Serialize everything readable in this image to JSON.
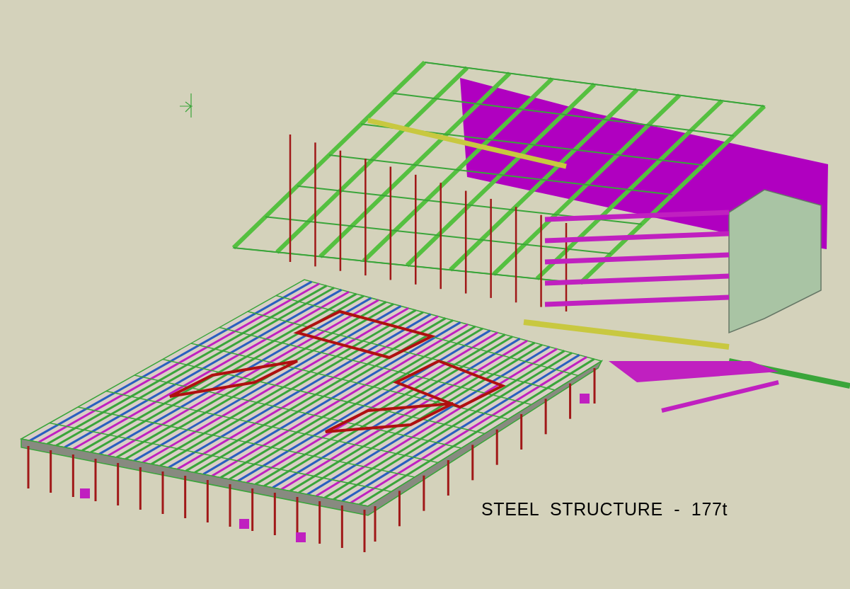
{
  "viewport": {
    "caption": "STEEL STRUCTURE - 177t"
  }
}
